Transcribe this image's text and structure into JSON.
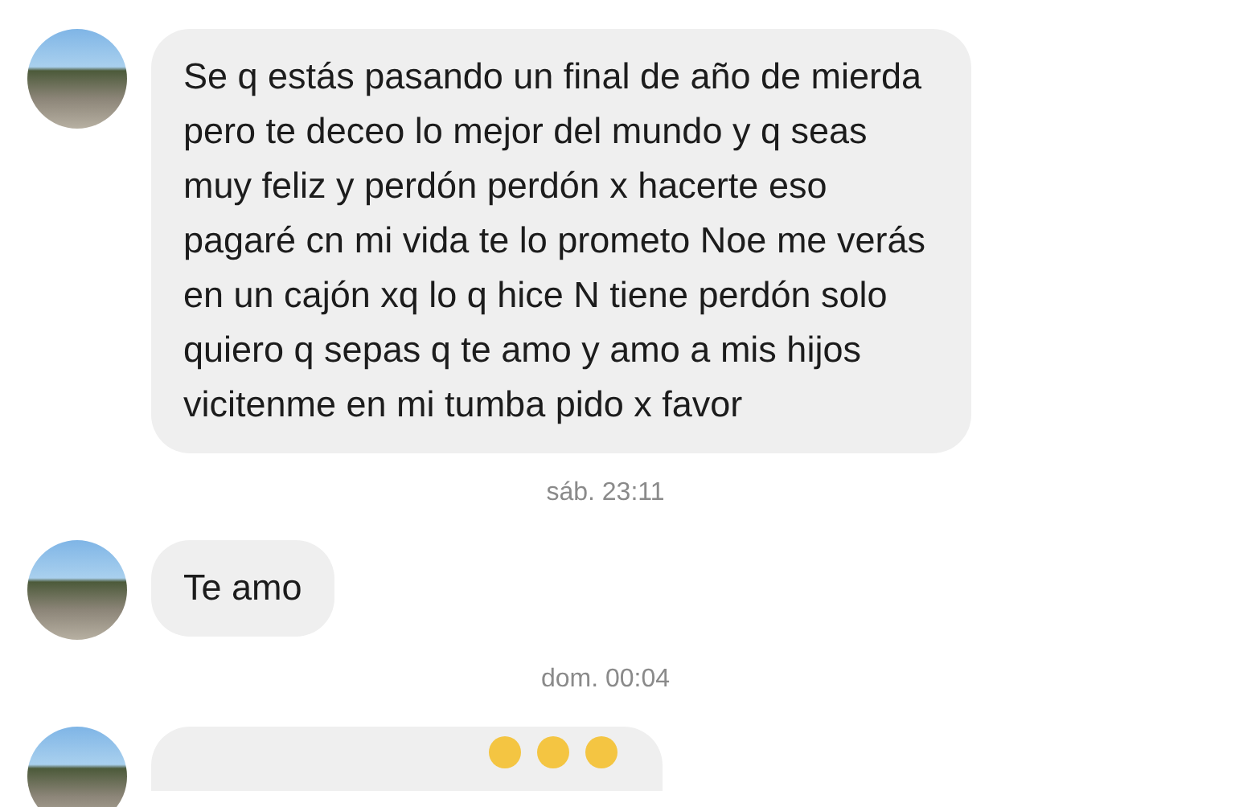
{
  "messages": [
    {
      "kind": "text",
      "text": "Se q estás pasando un final de año de mierda pero te deceo lo mejor del mundo y q seas muy feliz y perdón perdón x hacerte eso pagaré cn mi vida te lo prometo Noe me verás en un cajón xq lo q hice N tiene perdón solo quiero q sepas q te amo y amo a mis hijos vicitenme en mi tumba pido x favor"
    },
    {
      "kind": "time",
      "text": "sáb. 23:11"
    },
    {
      "kind": "text",
      "text": "Te amo"
    },
    {
      "kind": "time",
      "text": "dom. 00:04"
    },
    {
      "kind": "cut"
    }
  ]
}
